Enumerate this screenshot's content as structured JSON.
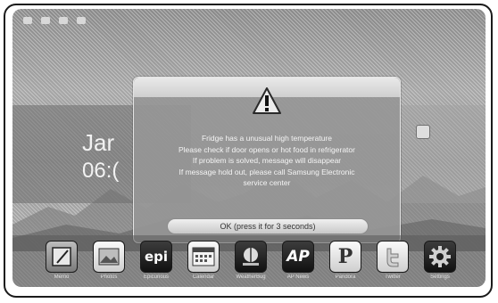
{
  "screen": {
    "date_partial": "Jar",
    "time_partial": "06:("
  },
  "dialog": {
    "icon": "warning-triangle-icon",
    "message_lines": [
      "Fridge has a unusual high temperature",
      "Please check if door opens or hot food in refrigerator",
      "If problem is solved, message will disappear",
      "If message hold out, please call Samsung Electronic",
      "service center"
    ],
    "ok_label": "OK (press it for 3 seconds)"
  },
  "dock": {
    "apps": [
      {
        "icon": "memo-icon",
        "glyph": "",
        "label": "Memo"
      },
      {
        "icon": "photos-icon",
        "glyph": "",
        "label": "Photos"
      },
      {
        "icon": "epicurious-icon",
        "glyph": "epi",
        "label": "Epicurious"
      },
      {
        "icon": "calendar-icon",
        "glyph": "",
        "label": "Calendar"
      },
      {
        "icon": "weatherbug-icon",
        "glyph": "",
        "label": "WeatherBug"
      },
      {
        "icon": "ap-news-icon",
        "glyph": "AP",
        "label": "AP News"
      },
      {
        "icon": "pandora-icon",
        "glyph": "P",
        "label": "Pandora"
      },
      {
        "icon": "twitter-icon",
        "glyph": "",
        "label": "Twitter"
      },
      {
        "icon": "settings-gear-icon",
        "glyph": "",
        "label": "Settings"
      }
    ]
  }
}
